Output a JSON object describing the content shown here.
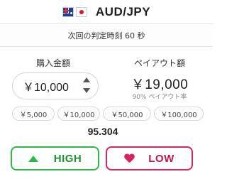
{
  "pair": {
    "name": "AUD/JPY",
    "base_flag": "australia-flag-icon",
    "quote_flag": "japan-flag-icon"
  },
  "countdown": {
    "text": "次回の判定時刻 60 秒"
  },
  "purchase": {
    "label": "購入金額",
    "value": "￥10,000"
  },
  "payout": {
    "label": "ペイアウト額",
    "value": "￥19,000",
    "rate_text": "90% ペイアウト率"
  },
  "quick_amounts": [
    "￥5,000",
    "￥10,000",
    "￥50,000",
    "￥100,000"
  ],
  "current_rate": "95.304",
  "buttons": {
    "high": {
      "label": "HIGH",
      "color": "#2eb84a"
    },
    "low": {
      "label": "LOW",
      "color": "#d6245f"
    }
  }
}
